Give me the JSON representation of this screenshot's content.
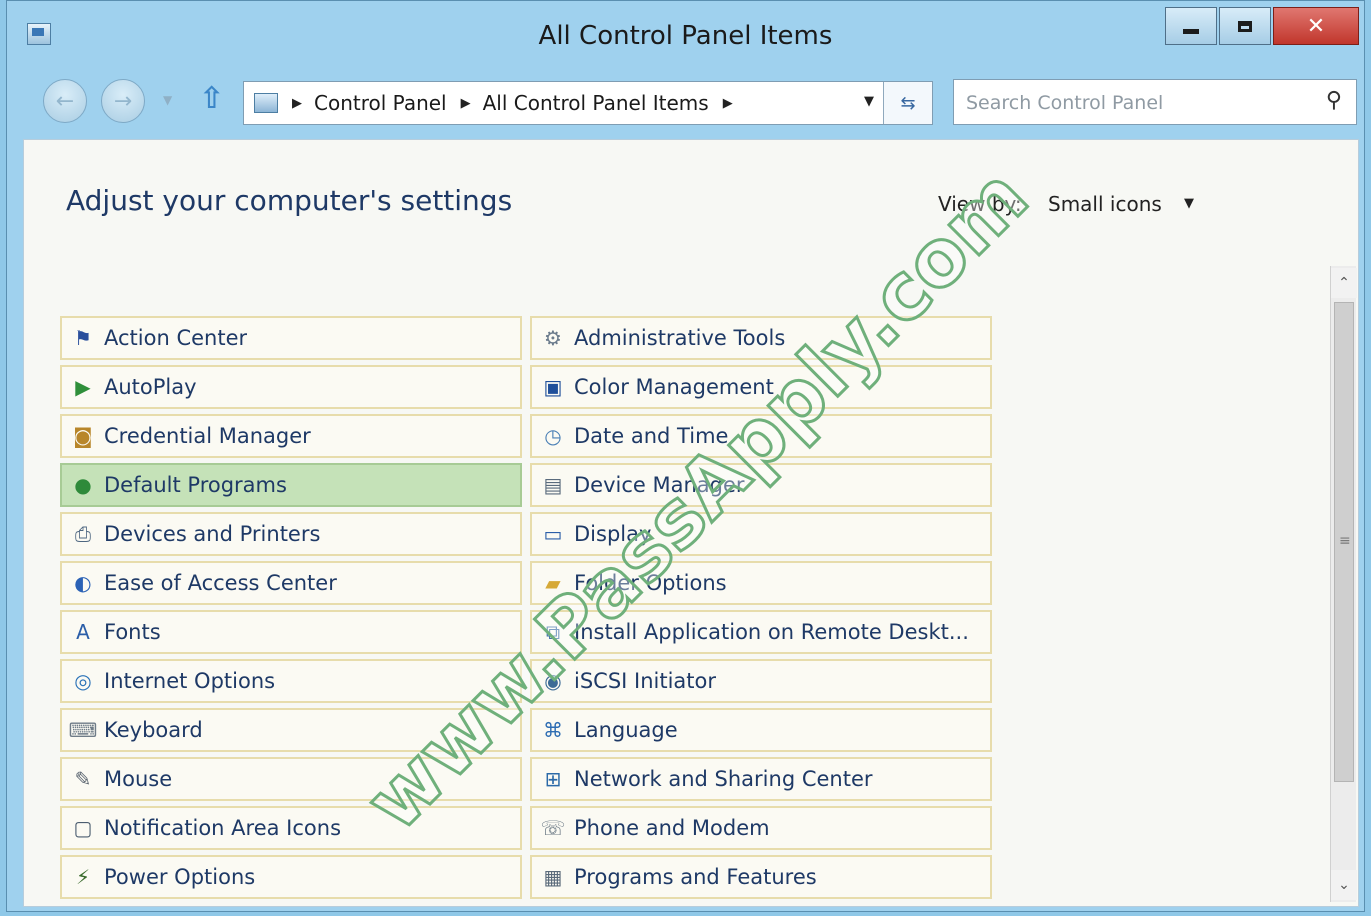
{
  "window": {
    "title": "All Control Panel Items"
  },
  "address": {
    "crumbs": [
      "Control Panel",
      "All Control Panel Items"
    ]
  },
  "search": {
    "placeholder": "Search Control Panel"
  },
  "content": {
    "heading": "Adjust your computer's settings",
    "view_by_label": "View by:",
    "view_by_value": "Small icons"
  },
  "items": [
    {
      "label": "Action Center",
      "icon": "flag-icon",
      "color": "#2a4f9c",
      "glyph": "⚑"
    },
    {
      "label": "Administrative Tools",
      "icon": "admin-tools-icon",
      "color": "#6b7b8c",
      "glyph": "⚙"
    },
    {
      "label": "AutoPlay",
      "icon": "autoplay-icon",
      "color": "#2f8f3a",
      "glyph": "▶"
    },
    {
      "label": "Color Management",
      "icon": "color-monitor-icon",
      "color": "#1f4f9a",
      "glyph": "▣"
    },
    {
      "label": "Credential Manager",
      "icon": "credential-vault-icon",
      "color": "#b8862a",
      "glyph": "◙"
    },
    {
      "label": "Date and Time",
      "icon": "clock-icon",
      "color": "#4a7fb5",
      "glyph": "◷"
    },
    {
      "label": "Default Programs",
      "icon": "default-programs-icon",
      "color": "#2e8a3a",
      "glyph": "●",
      "selected": true
    },
    {
      "label": "Device Manager",
      "icon": "device-manager-icon",
      "color": "#5a6b7d",
      "glyph": "▤"
    },
    {
      "label": "Devices and Printers",
      "icon": "printer-icon",
      "color": "#4d6680",
      "glyph": "⎙"
    },
    {
      "label": "Display",
      "icon": "display-icon",
      "color": "#2b5ea8",
      "glyph": "▭"
    },
    {
      "label": "Ease of Access Center",
      "icon": "ease-of-access-icon",
      "color": "#2b62b5",
      "glyph": "◐"
    },
    {
      "label": "Folder Options",
      "icon": "folder-icon",
      "color": "#d6a937",
      "glyph": "▰"
    },
    {
      "label": "Fonts",
      "icon": "fonts-icon",
      "color": "#2b5ea8",
      "glyph": "A"
    },
    {
      "label": "Install Application on Remote Deskt...",
      "icon": "remote-install-icon",
      "color": "#3b6ea8",
      "glyph": "⧉"
    },
    {
      "label": "Internet Options",
      "icon": "internet-options-icon",
      "color": "#2c73b8",
      "glyph": "◎"
    },
    {
      "label": "iSCSI Initiator",
      "icon": "iscsi-icon",
      "color": "#3c6b96",
      "glyph": "◉"
    },
    {
      "label": "Keyboard",
      "icon": "keyboard-icon",
      "color": "#6f7c88",
      "glyph": "⌨"
    },
    {
      "label": "Language",
      "icon": "language-icon",
      "color": "#2e6db3",
      "glyph": "⌘"
    },
    {
      "label": "Mouse",
      "icon": "mouse-icon",
      "color": "#5b6570",
      "glyph": "✎"
    },
    {
      "label": "Network and Sharing Center",
      "icon": "network-icon",
      "color": "#2b6aa8",
      "glyph": "⊞"
    },
    {
      "label": "Notification Area Icons",
      "icon": "notification-area-icon",
      "color": "#4b5d70",
      "glyph": "▢"
    },
    {
      "label": "Phone and Modem",
      "icon": "phone-modem-icon",
      "color": "#6c7a86",
      "glyph": "☏"
    },
    {
      "label": "Power Options",
      "icon": "power-icon",
      "color": "#3a6b2c",
      "glyph": "⚡"
    },
    {
      "label": "Programs and Features",
      "icon": "programs-features-icon",
      "color": "#5a6a7a",
      "glyph": "▦"
    }
  ],
  "watermark": "www.PassApply.com"
}
